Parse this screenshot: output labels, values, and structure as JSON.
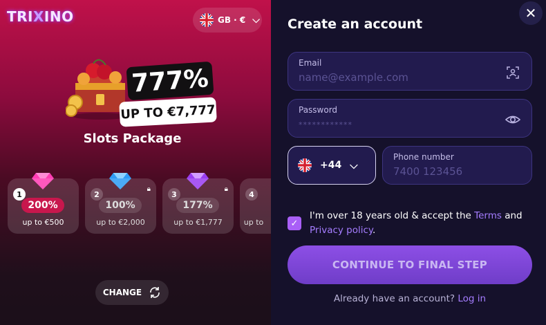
{
  "brand": {
    "logo_text_a": "TRI",
    "logo_text_b": "X",
    "logo_text_c": "INO"
  },
  "locale": {
    "label": "GB · €"
  },
  "promo": {
    "percent": "777%",
    "up_to": "UP TO €7,777",
    "package_title": "Slots Package",
    "cards": [
      {
        "num": "1",
        "pct": "200%",
        "sub": "up to €500",
        "active": true
      },
      {
        "num": "2",
        "pct": "100%",
        "sub": "up to €2,000",
        "active": false
      },
      {
        "num": "3",
        "pct": "177%",
        "sub": "up to €1,777",
        "active": false
      },
      {
        "num": "4",
        "pct": "",
        "sub": "up to",
        "active": false
      }
    ],
    "change_label": "CHANGE"
  },
  "form": {
    "title": "Create an account",
    "email_label": "Email",
    "email_placeholder": "name@example.com",
    "password_label": "Password",
    "password_placeholder": "************",
    "phone_code": "+44",
    "phone_label": "Phone number",
    "phone_placeholder": "7400 123456",
    "consent_prefix": "I'm over 18 years old & accept the ",
    "consent_terms": "Terms",
    "consent_and": " and ",
    "consent_privacy": "Privacy policy",
    "consent_suffix": ".",
    "cta_label": "CONTINUE TO FINAL STEP",
    "login_prompt": "Already have an account?",
    "login_link": "Log in"
  },
  "close_label": "✕",
  "colors": {
    "accent": "#a57dff",
    "cta": "#7a44d6",
    "promo_red": "#c8174d",
    "panel": "#15112b"
  }
}
